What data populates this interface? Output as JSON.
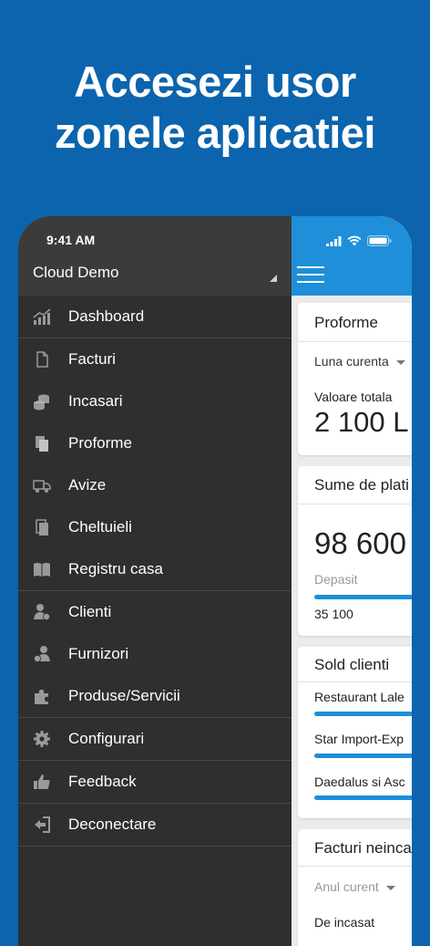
{
  "headline": {
    "line1": "Accesezi usor",
    "line2": "zonele aplicatiei"
  },
  "status": {
    "time": "9:41 AM"
  },
  "drawer": {
    "account": "Cloud Demo",
    "items": [
      {
        "label": "Dashboard",
        "icon": "chart-icon"
      },
      {
        "label": "Facturi",
        "icon": "document-icon"
      },
      {
        "label": "Incasari",
        "icon": "coins-icon"
      },
      {
        "label": "Proforme",
        "icon": "documents-icon"
      },
      {
        "label": "Avize",
        "icon": "truck-icon"
      },
      {
        "label": "Cheltuieli",
        "icon": "receipts-icon"
      },
      {
        "label": "Registru casa",
        "icon": "book-icon"
      },
      {
        "label": "Clienti",
        "icon": "clients-icon"
      },
      {
        "label": "Furnizori",
        "icon": "suppliers-icon"
      },
      {
        "label": "Produse/Servicii",
        "icon": "puzzle-icon"
      },
      {
        "label": "Configurari",
        "icon": "gear-icon"
      },
      {
        "label": "Feedback",
        "icon": "thumbs-up-icon"
      },
      {
        "label": "Deconectare",
        "icon": "logout-icon"
      }
    ]
  },
  "cards": {
    "proforme": {
      "title": "Proforme",
      "period": "Luna curenta",
      "total_label": "Valoare totala",
      "total_value": "2 100 L"
    },
    "sume": {
      "title": "Sume de plati",
      "amount": "98 600",
      "overdue_label": "Depasit",
      "overdue_value": "35 100"
    },
    "sold": {
      "title": "Sold clienti",
      "clients": [
        "Restaurant Lale",
        "Star Import-Exp",
        "Daedalus si Asc"
      ]
    },
    "facturi": {
      "title": "Facturi neinca",
      "period": "Anul curent",
      "label": "De incasat"
    }
  },
  "colors": {
    "background": "#0b64ad",
    "accent": "#1e8fd8",
    "drawer": "#2f2f2f"
  }
}
